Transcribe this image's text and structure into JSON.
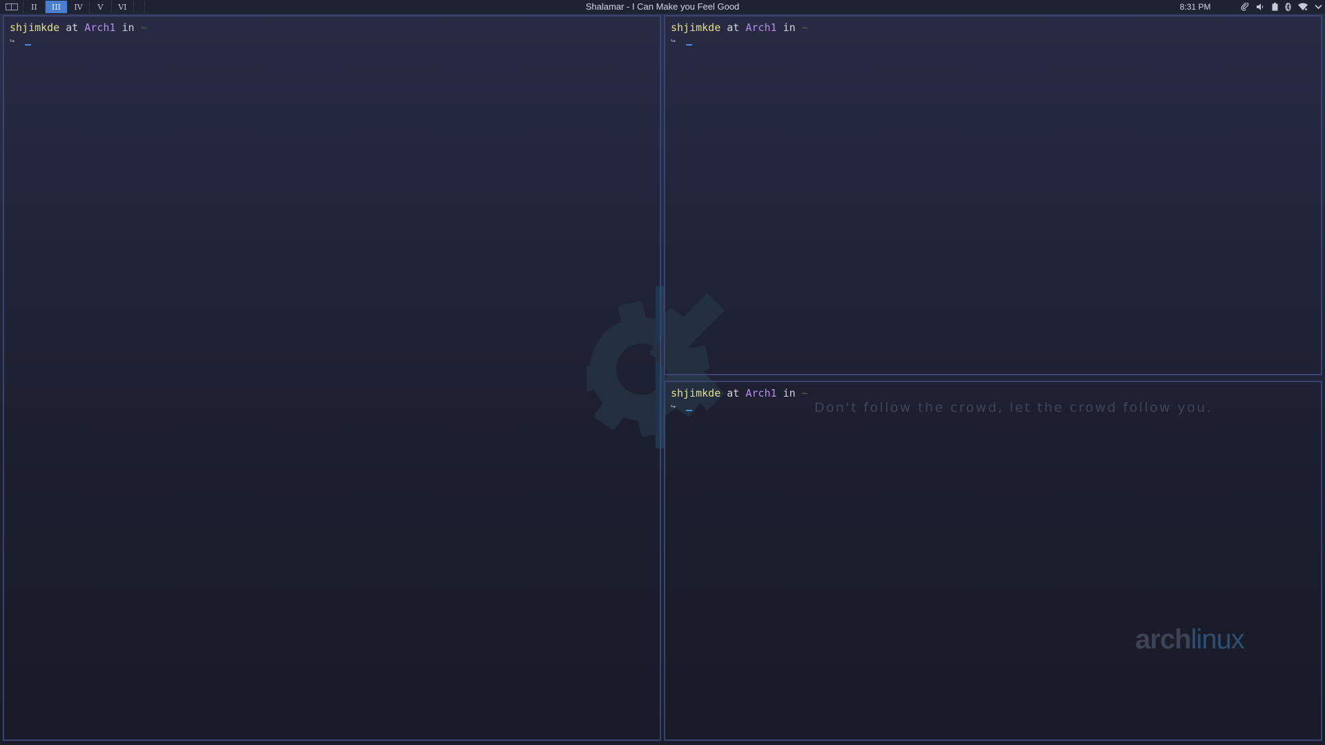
{
  "panel": {
    "workspaces": [
      "II",
      "III",
      "IV",
      "V",
      "VI"
    ],
    "active_workspace": "III",
    "window_title": "Shalamar - I Can Make you Feel Good",
    "clock": "8:31 PM",
    "tray_icons": [
      "paperclip-icon",
      "volume-icon",
      "battery-icon",
      "bluetooth-icon",
      "wifi-icon",
      "chevron-down-icon"
    ]
  },
  "terminals": [
    {
      "user": "shjimkde",
      "at": "at",
      "host": "Arch1",
      "in": "in",
      "dir": "~",
      "arrow": "↪"
    },
    {
      "user": "shjimkde",
      "at": "at",
      "host": "Arch1",
      "in": "in",
      "dir": "~",
      "arrow": "↪"
    },
    {
      "user": "shjimkde",
      "at": "at",
      "host": "Arch1",
      "in": "in",
      "dir": "~",
      "arrow": "↪"
    }
  ],
  "wallpaper": {
    "quote": "Don't follow the crowd, let the crowd follow you.",
    "brand_bold": "arch",
    "brand_light": "linux"
  },
  "colors": {
    "accent": "#4a7fd0",
    "user": "#e6e08a",
    "host": "#b88df0",
    "dir": "#46704e",
    "border": "#3b4470"
  }
}
